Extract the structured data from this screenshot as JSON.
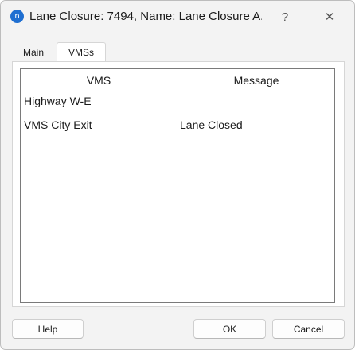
{
  "window": {
    "app_icon_glyph": "n",
    "title": "Lane Closure: 7494, Name: Lane Closure A...",
    "help_glyph": "?",
    "close_glyph": "✕"
  },
  "tabs": [
    {
      "label": "Main",
      "selected": false
    },
    {
      "label": "VMSs",
      "selected": true
    }
  ],
  "vms_table": {
    "columns": [
      "VMS",
      "Message"
    ],
    "rows": [
      {
        "vms": "Highway W-E",
        "message": ""
      },
      {
        "vms": "VMS City Exit",
        "message": "Lane Closed"
      }
    ]
  },
  "buttons": {
    "help": "Help",
    "ok": "OK",
    "cancel": "Cancel"
  }
}
